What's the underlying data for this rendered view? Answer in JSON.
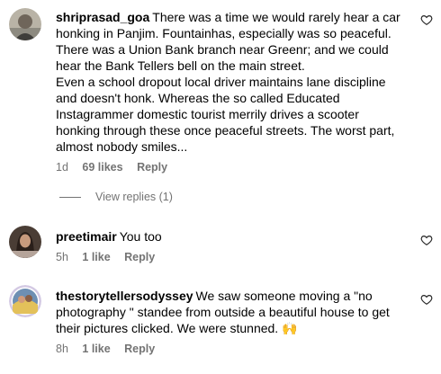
{
  "comments": [
    {
      "username": "shriprasad_goa",
      "lines": [
        "There was a time we would rarely hear a car",
        "honking in Panjim. Fountainhas, especially was so peaceful.",
        "There was a Union Bank branch near Greenr; and we could",
        "hear the Bank Tellers bell on the main street.",
        "Even a school dropout local driver maintains lane discipline",
        "and doesn't honk. Whereas the so called Educated",
        "Instagrammer domestic tourist merrily drives a scooter",
        "honking through these once peaceful streets. The worst part,",
        "almost nobody smiles..."
      ],
      "time": "1d",
      "likes": "69 likes",
      "reply": "Reply",
      "view_replies": "View replies (1)",
      "like_icon": "heart-outline-icon"
    },
    {
      "username": "preetimair",
      "lines": [
        "You too"
      ],
      "time": "5h",
      "likes": "1 like",
      "reply": "Reply",
      "like_icon": "heart-outline-icon"
    },
    {
      "username": "thestorytellersodyssey",
      "lines": [
        "We saw someone moving a \"no",
        "photography \" standee from outside a beautiful house to get",
        "their pictures clicked. We were stunned. 🙌"
      ],
      "time": "8h",
      "likes": "1 like",
      "reply": "Reply",
      "like_icon": "heart-outline-icon"
    }
  ],
  "colors": {
    "text": "#000000",
    "secondary": "#737373",
    "background": "#ffffff"
  }
}
